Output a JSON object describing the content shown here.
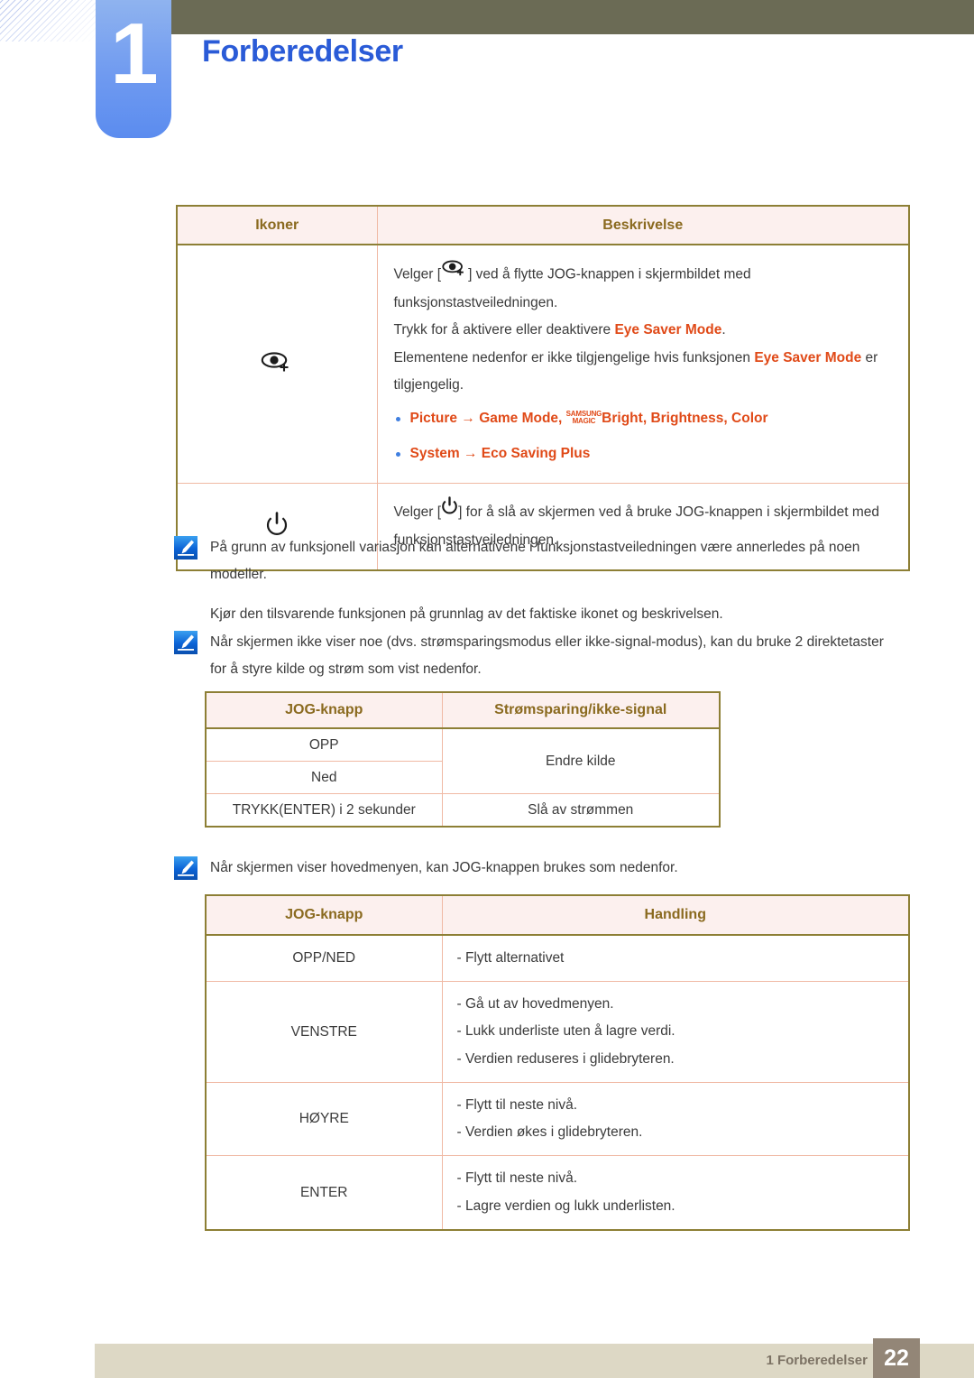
{
  "header": {
    "chapter_number": "1",
    "chapter_title": "Forberedelser",
    "accent_blue": "#2a5bd7",
    "olive": "#6b6b55"
  },
  "icon_table": {
    "headers": [
      "Ikoner",
      "Beskrivelse"
    ],
    "rows": [
      {
        "icon": "eye-plus-icon",
        "lines": {
          "l1_a": "Velger [",
          "l1_b": "] ved å flytte JOG-knappen i skjermbildet med funksjonstastveiledningen.",
          "l2_a": "Trykk for å aktivere eller deaktivere ",
          "l2_hl": "Eye Saver Mode",
          "l2_b": ".",
          "l3_a": "Elementene nedenfor er ikke tilgjengelige hvis funksjonen ",
          "l3_hl": "Eye Saver Mode",
          "l3_b": " er tilgjengelig.",
          "b1_picture": "Picture",
          "b1_arrow": "→",
          "b1_game": "Game Mode",
          "b1_magic_top": "SAMSUNG",
          "b1_magic_bottom": "MAGIC",
          "b1_bright": "Bright",
          "b1_brightness": "Brightness",
          "b1_color": "Color",
          "b2_system": "System",
          "b2_arrow": "→",
          "b2_eco": "Eco Saving Plus"
        }
      },
      {
        "icon": "power-icon",
        "lines": {
          "l1_a": "Velger [",
          "l1_b": "] for å slå av skjermen ved å bruke JOG-knappen i skjermbildet med funksjonstastveiledningen."
        }
      }
    ]
  },
  "note1": {
    "icon": "note-pencil-icon",
    "paragraphs": [
      "På grunn av funksjonell variasjon kan alternativene i funksjonstastveiledningen være annerledes på noen modeller.",
      "Kjør den tilsvarende funksjonen på grunnlag av det faktiske ikonet og beskrivelsen."
    ]
  },
  "note2": {
    "icon": "note-pencil-icon",
    "paragraphs": [
      "Når skjermen ikke viser noe (dvs. strømsparingsmodus eller ikke-signal-modus), kan du bruke 2 direktetaster for å styre kilde og strøm som vist nedenfor."
    ]
  },
  "note3": {
    "icon": "note-pencil-icon",
    "paragraphs": [
      "Når skjermen viser hovedmenyen, kan JOG-knappen brukes som nedenfor."
    ]
  },
  "direct_table": {
    "headers": [
      "JOG-knapp",
      "Strømsparing/ikke-signal"
    ],
    "rows": [
      {
        "key": "OPP",
        "action": "Endre kilde"
      },
      {
        "key": "Ned",
        "action": ""
      },
      {
        "key": "TRYKK(ENTER) i 2 sekunder",
        "action": "Slå av strømmen"
      }
    ]
  },
  "menu_table": {
    "headers": [
      "JOG-knapp",
      "Handling"
    ],
    "rows": [
      {
        "key": "OPP/NED",
        "actions": [
          "- Flytt alternativet"
        ]
      },
      {
        "key": "VENSTRE",
        "actions": [
          "- Gå ut av hovedmenyen.",
          "- Lukk underliste uten å lagre verdi.",
          "- Verdien reduseres i glidebryteren."
        ]
      },
      {
        "key": "HØYRE",
        "actions": [
          "- Flytt til neste nivå.",
          "- Verdien økes i glidebryteren."
        ]
      },
      {
        "key": "ENTER",
        "actions": [
          "- Flytt til neste nivå.",
          "- Lagre verdien og lukk underlisten."
        ]
      }
    ]
  },
  "footer": {
    "chapter_label": "1 Forberedelser",
    "page_number": "22"
  }
}
